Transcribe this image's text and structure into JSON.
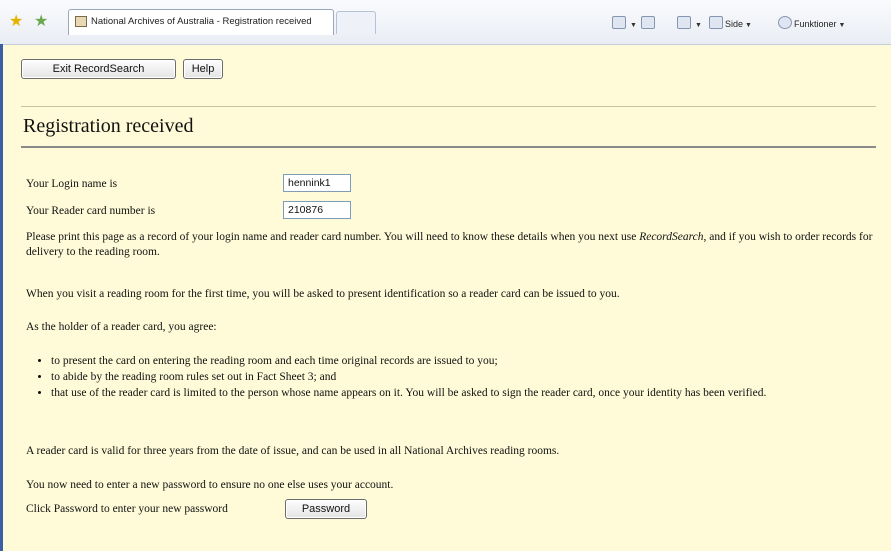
{
  "browser": {
    "tab_title": "National Archives of Australia - Registration received",
    "commands": {
      "page": "Side",
      "tools": "Funktioner"
    },
    "icons": [
      "favorites-star-icon",
      "add-favorites-icon",
      "home-icon",
      "feeds-icon",
      "print-icon",
      "page-icon",
      "tools-icon"
    ]
  },
  "toolbar": {
    "exit_label": "Exit RecordSearch",
    "help_label": "Help"
  },
  "page": {
    "title": "Registration received",
    "login_label": "Your Login name is",
    "login_value": "hennink1",
    "card_label": "Your Reader card number is",
    "card_value": "210876",
    "print_note_a": "Please print this page as a record of your login name and reader card number. You will need to know these details when you next use ",
    "print_note_em": "RecordSearch",
    "print_note_b": ", and if you wish to order records for delivery to the reading room.",
    "visit_note": "When you visit a reading room for the first time, you will be asked to present identification so a reader card can be issued to you.",
    "agree_intro": "As the holder of a reader card, you agree:",
    "terms": [
      "to present the card on entering the reading room and each time original records are issued to you;",
      "to abide by the reading room rules set out in Fact Sheet 3; and",
      "that use of the reader card is limited to the person whose name appears on it. You will be asked to sign the reader card, once your identity has been verified."
    ],
    "validity_note": "A reader card is valid for three years from the date of issue, and can be used in all National Archives reading rooms.",
    "password_note": "You now need to enter a new password to ensure no one else uses your account.",
    "password_prompt": "Click Password to enter your new password",
    "password_button": "Password"
  }
}
